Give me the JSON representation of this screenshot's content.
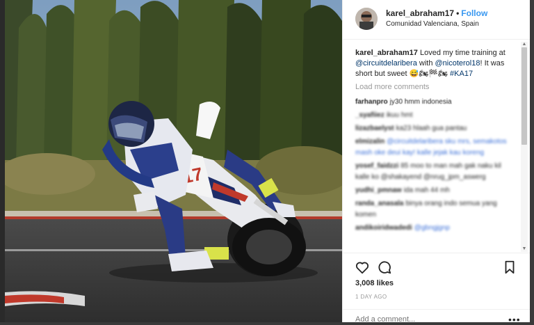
{
  "post": {
    "username": "karel_abraham17",
    "separator": "•",
    "follow_label": "Follow",
    "location": "Comunidad Valenciana, Spain",
    "caption": {
      "username": "karel_abraham17",
      "text_1": " Loved my time training at ",
      "mention_1": "@circuitdelaribera",
      "text_2": " with ",
      "mention_2": "@nicoterol18",
      "text_3": "! It was short but sweet 😅🏍🏁🏍 ",
      "hashtag": "#KA17"
    },
    "load_more_label": "Load more comments",
    "comments": [
      {
        "user": "farhanpro",
        "text": "jy30 hmm indonesia"
      },
      {
        "user": "_syafiiez",
        "text": "ikuu hmt"
      },
      {
        "user": "lizazbaelyst",
        "text": "ka23 hlaah gua pantau"
      },
      {
        "user": "elmizalin",
        "text": "@circuitdelaribera sku mrs, semakotos mash oke deui kay! kalle jejak kau koreng"
      },
      {
        "user": "yosef_faidzzi",
        "text": "85 moo to man mah gak naku kil kalle ko @shakayend @nrug_jpm_aswerg"
      },
      {
        "user": "yudhi_pmnaw",
        "text": "ida mah 44 mh"
      },
      {
        "user": "randa_anasala",
        "text": "binya orang indo semua yang komen"
      },
      {
        "user": "andikoiridwadedi",
        "text": "@gbngjgnp"
      }
    ],
    "likes": "3,008 likes",
    "time_ago": "1 DAY AGO",
    "add_comment_placeholder": "Add a comment...",
    "more_label": "•••"
  },
  "icons": {
    "heart": "heart-icon",
    "comment": "comment-icon",
    "bookmark": "bookmark-icon",
    "more": "more-options-icon"
  },
  "colors": {
    "follow": "#3897f0",
    "mention": "#003569",
    "text": "#262626",
    "muted": "#999999"
  }
}
